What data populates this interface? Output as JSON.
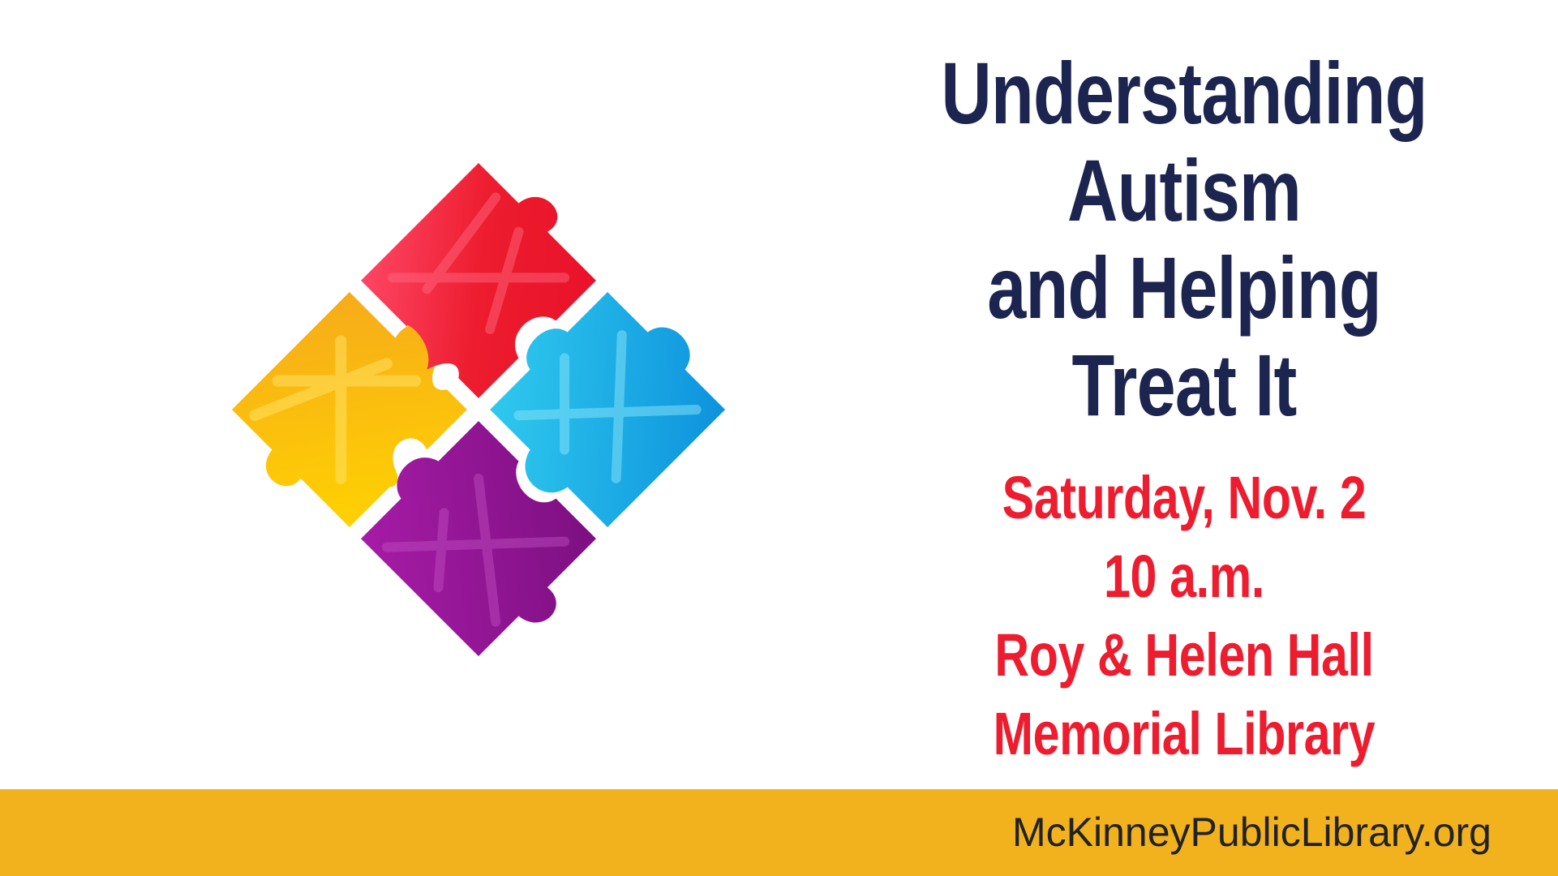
{
  "poster": {
    "title_lines": [
      "Understanding",
      "Autism",
      "and Helping",
      "Treat It"
    ],
    "detail_lines": [
      "Saturday, Nov. 2",
      "10 a.m.",
      "Roy & Helen Hall",
      "Memorial Library"
    ],
    "footer_url": "McKinneyPublicLibrary.org"
  },
  "graphic": {
    "icon": "puzzle-pieces-icon",
    "pieces": [
      {
        "name": "yellow",
        "color": "#fbb70f"
      },
      {
        "name": "purple",
        "color": "#8d1a8c"
      },
      {
        "name": "red",
        "color": "#ed1c2e"
      },
      {
        "name": "blue",
        "color": "#1ea7e4"
      }
    ]
  },
  "colors": {
    "title": "#1c2450",
    "details": "#ed1c2e",
    "footer_bar": "#f1b21e",
    "footer_text": "#222222",
    "background": "#ffffff"
  }
}
